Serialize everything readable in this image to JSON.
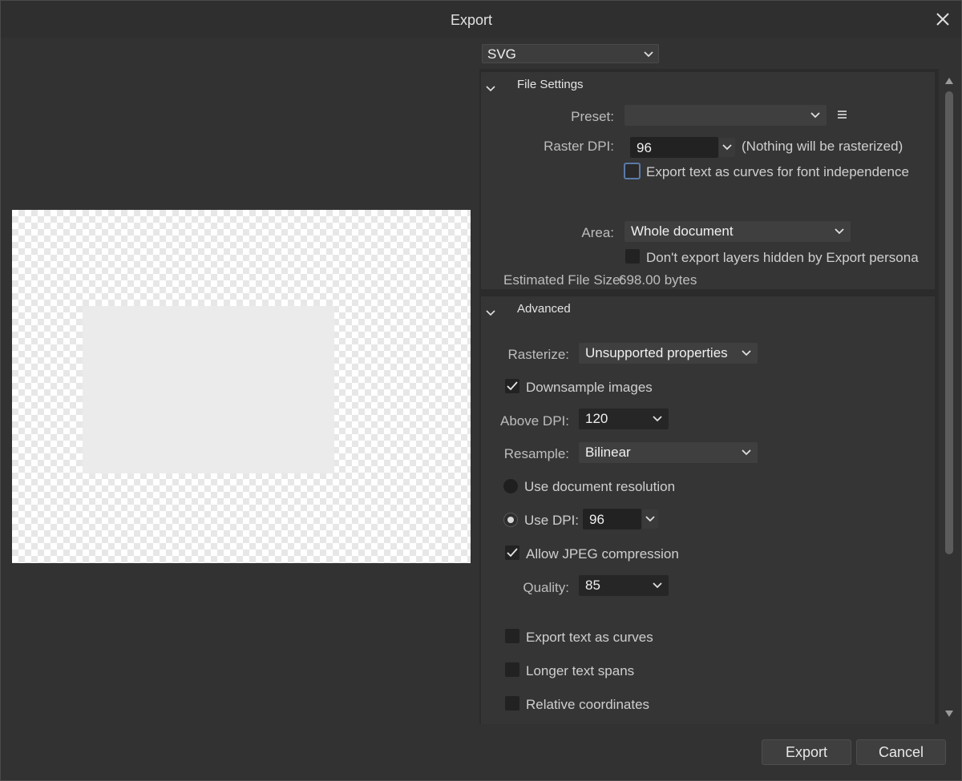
{
  "window": {
    "title": "Export"
  },
  "format": {
    "selected": "SVG"
  },
  "file_settings": {
    "header": "File Settings",
    "preset_label": "Preset:",
    "preset_value": "",
    "raster_dpi_label": "Raster DPI:",
    "raster_dpi_value": "96",
    "raster_dpi_note": "(Nothing will be rasterized)",
    "text_as_curves_label": "Export text as curves for font independence",
    "text_as_curves_checked": false,
    "area_label": "Area:",
    "area_value": "Whole document",
    "hidden_layers_label": "Don't export layers hidden by Export persona",
    "hidden_layers_checked": false,
    "estimated_size_label": "Estimated File Size:",
    "estimated_size_value": "698.00 bytes"
  },
  "advanced": {
    "header": "Advanced",
    "rasterize_label": "Rasterize:",
    "rasterize_value": "Unsupported properties",
    "downsample_label": "Downsample images",
    "downsample_checked": true,
    "above_dpi_label": "Above DPI:",
    "above_dpi_value": "120",
    "resample_label": "Resample:",
    "resample_value": "Bilinear",
    "use_doc_res_label": "Use document resolution",
    "use_dpi_label": "Use DPI:",
    "use_dpi_value": "96",
    "selected_resolution_mode": "Use DPI",
    "jpeg_label": "Allow JPEG compression",
    "jpeg_checked": true,
    "quality_label": "Quality:",
    "quality_value": "85",
    "text_curves_label": "Export text as curves",
    "text_curves_checked": false,
    "longer_spans_label": "Longer text spans",
    "longer_spans_checked": false,
    "relative_coords_label": "Relative coordinates",
    "relative_coords_checked": false
  },
  "buttons": {
    "export": "Export",
    "cancel": "Cancel"
  },
  "colors": {
    "background": "#323232",
    "panel": "#353535",
    "field": "#222222",
    "text": "#d6d6d6",
    "focus_border": "#5a7aa8"
  }
}
